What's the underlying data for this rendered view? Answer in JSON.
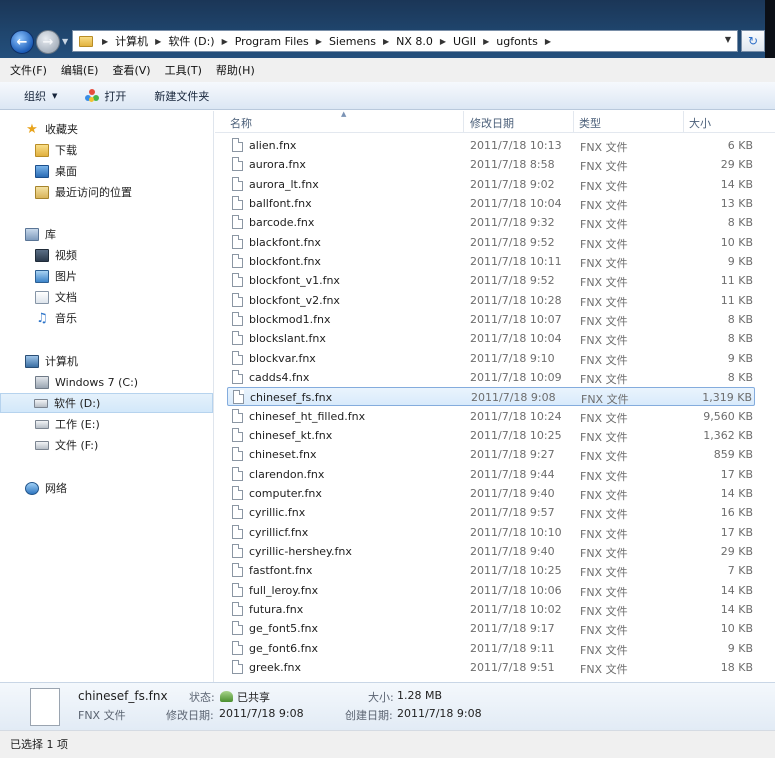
{
  "breadcrumb": [
    "计算机",
    "软件 (D:)",
    "Program Files",
    "Siemens",
    "NX 8.0",
    "UGII",
    "ugfonts"
  ],
  "menu": [
    "文件(F)",
    "编辑(E)",
    "查看(V)",
    "工具(T)",
    "帮助(H)"
  ],
  "toolbar": {
    "organize": "组织",
    "open": "打开",
    "new_folder": "新建文件夹"
  },
  "nav": {
    "favorites": "收藏夹",
    "downloads": "下载",
    "desktop": "桌面",
    "recent": "最近访问的位置",
    "libraries": "库",
    "videos": "视频",
    "pictures": "图片",
    "documents": "文档",
    "music": "音乐",
    "computer": "计算机",
    "drive_c": "Windows 7 (C:)",
    "drive_d": "软件 (D:)",
    "drive_e": "工作 (E:)",
    "drive_f": "文件 (F:)",
    "network": "网络"
  },
  "columns": {
    "name": "名称",
    "date": "修改日期",
    "type": "类型",
    "size": "大小"
  },
  "files": [
    {
      "name": "alien.fnx",
      "date": "2011/7/18 10:13",
      "type": "FNX 文件",
      "size": "6 KB"
    },
    {
      "name": "aurora.fnx",
      "date": "2011/7/18 8:58",
      "type": "FNX 文件",
      "size": "29 KB"
    },
    {
      "name": "aurora_lt.fnx",
      "date": "2011/7/18 9:02",
      "type": "FNX 文件",
      "size": "14 KB"
    },
    {
      "name": "ballfont.fnx",
      "date": "2011/7/18 10:04",
      "type": "FNX 文件",
      "size": "13 KB"
    },
    {
      "name": "barcode.fnx",
      "date": "2011/7/18 9:32",
      "type": "FNX 文件",
      "size": "8 KB"
    },
    {
      "name": "blackfont.fnx",
      "date": "2011/7/18 9:52",
      "type": "FNX 文件",
      "size": "10 KB"
    },
    {
      "name": "blockfont.fnx",
      "date": "2011/7/18 10:11",
      "type": "FNX 文件",
      "size": "9 KB"
    },
    {
      "name": "blockfont_v1.fnx",
      "date": "2011/7/18 9:52",
      "type": "FNX 文件",
      "size": "11 KB"
    },
    {
      "name": "blockfont_v2.fnx",
      "date": "2011/7/18 10:28",
      "type": "FNX 文件",
      "size": "11 KB"
    },
    {
      "name": "blockmod1.fnx",
      "date": "2011/7/18 10:07",
      "type": "FNX 文件",
      "size": "8 KB"
    },
    {
      "name": "blockslant.fnx",
      "date": "2011/7/18 10:04",
      "type": "FNX 文件",
      "size": "8 KB"
    },
    {
      "name": "blockvar.fnx",
      "date": "2011/7/18 9:10",
      "type": "FNX 文件",
      "size": "9 KB"
    },
    {
      "name": "cadds4.fnx",
      "date": "2011/7/18 10:09",
      "type": "FNX 文件",
      "size": "8 KB"
    },
    {
      "name": "chinesef_fs.fnx",
      "date": "2011/7/18 9:08",
      "type": "FNX 文件",
      "size": "1,319 KB",
      "selected": true
    },
    {
      "name": "chinesef_ht_filled.fnx",
      "date": "2011/7/18 10:24",
      "type": "FNX 文件",
      "size": "9,560 KB"
    },
    {
      "name": "chinesef_kt.fnx",
      "date": "2011/7/18 10:25",
      "type": "FNX 文件",
      "size": "1,362 KB"
    },
    {
      "name": "chineset.fnx",
      "date": "2011/7/18 9:27",
      "type": "FNX 文件",
      "size": "859 KB"
    },
    {
      "name": "clarendon.fnx",
      "date": "2011/7/18 9:44",
      "type": "FNX 文件",
      "size": "17 KB"
    },
    {
      "name": "computer.fnx",
      "date": "2011/7/18 9:40",
      "type": "FNX 文件",
      "size": "14 KB"
    },
    {
      "name": "cyrillic.fnx",
      "date": "2011/7/18 9:57",
      "type": "FNX 文件",
      "size": "16 KB"
    },
    {
      "name": "cyrillicf.fnx",
      "date": "2011/7/18 10:10",
      "type": "FNX 文件",
      "size": "17 KB"
    },
    {
      "name": "cyrillic-hershey.fnx",
      "date": "2011/7/18 9:40",
      "type": "FNX 文件",
      "size": "29 KB"
    },
    {
      "name": "fastfont.fnx",
      "date": "2011/7/18 10:25",
      "type": "FNX 文件",
      "size": "7 KB"
    },
    {
      "name": "full_leroy.fnx",
      "date": "2011/7/18 10:06",
      "type": "FNX 文件",
      "size": "14 KB"
    },
    {
      "name": "futura.fnx",
      "date": "2011/7/18 10:02",
      "type": "FNX 文件",
      "size": "14 KB"
    },
    {
      "name": "ge_font5.fnx",
      "date": "2011/7/18 9:17",
      "type": "FNX 文件",
      "size": "10 KB"
    },
    {
      "name": "ge_font6.fnx",
      "date": "2011/7/18 9:11",
      "type": "FNX 文件",
      "size": "9 KB"
    },
    {
      "name": "greek.fnx",
      "date": "2011/7/18 9:51",
      "type": "FNX 文件",
      "size": "18 KB"
    }
  ],
  "details": {
    "filename": "chinesef_fs.fnx",
    "filetype": "FNX 文件",
    "status_label": "状态:",
    "status_value": "已共享",
    "modified_label": "修改日期:",
    "modified_value": "2011/7/18 9:08",
    "size_label": "大小:",
    "size_value": "1.28 MB",
    "created_label": "创建日期:",
    "created_value": "2011/7/18 9:08"
  },
  "status": {
    "text": "已选择 1 项"
  }
}
